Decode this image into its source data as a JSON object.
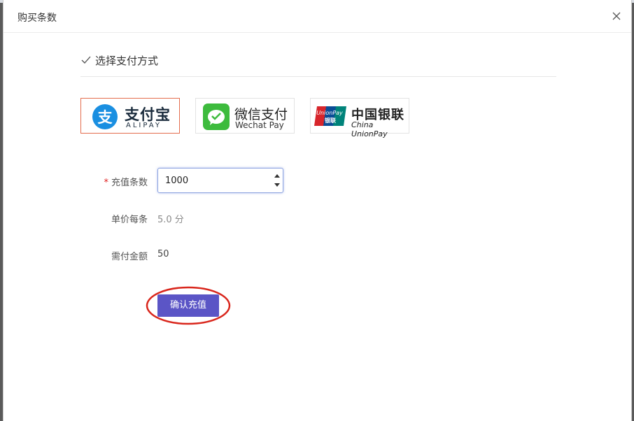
{
  "dialog": {
    "title": "购买条数",
    "close_icon": "close-icon"
  },
  "section": {
    "title": "选择支付方式",
    "icon": "check-icon"
  },
  "payment_methods": [
    {
      "name_cn": "支付宝",
      "name_en": "ALIPAY",
      "selected": true,
      "brand_color": "#1a8fe1"
    },
    {
      "name_cn": "微信支付",
      "name_en": "Wechat Pay",
      "selected": false,
      "brand_color": "#3dbb3d"
    },
    {
      "name_cn": "中国银联",
      "name_en": "China UnionPay",
      "selected": false,
      "logo_text": "UnionPay",
      "logo_text_cn": "银联",
      "brand_color": "#d7252b"
    }
  ],
  "form": {
    "quantity_label": "充值条数",
    "quantity_value": "1000",
    "required_mark": "*",
    "unit_price_label": "单价每条",
    "unit_price_value": "5.0 分",
    "total_label": "需付金额",
    "total_value": "50"
  },
  "confirm_button": "确认充值",
  "colors": {
    "accent": "#5b55c6",
    "selected_border": "#e46d4e",
    "annotation_ring": "#d9261c"
  }
}
